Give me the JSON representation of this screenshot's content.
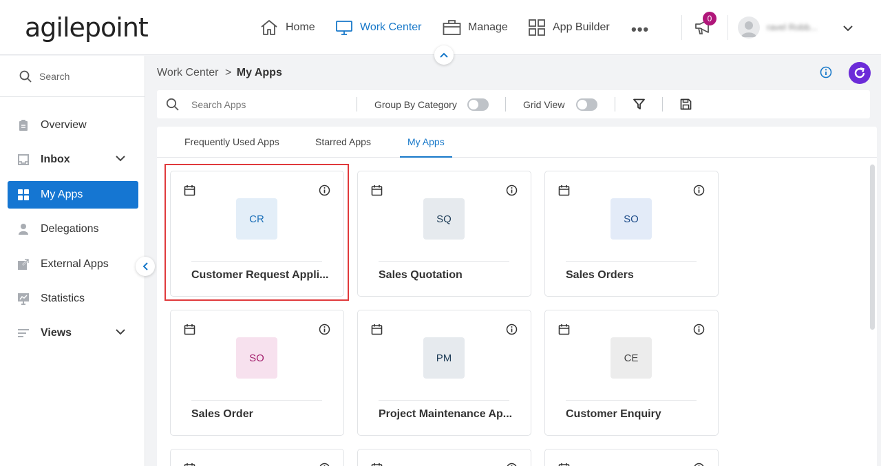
{
  "header": {
    "logo": "agilepoint",
    "nav": [
      {
        "label": "Home",
        "icon": "home-icon",
        "active": false
      },
      {
        "label": "Work Center",
        "icon": "monitor-icon",
        "active": true
      },
      {
        "label": "Manage",
        "icon": "briefcase-icon",
        "active": false
      },
      {
        "label": "App Builder",
        "icon": "grid-icon",
        "active": false
      }
    ],
    "more": "•••",
    "notification_count": "0",
    "username": "ravel Robb..."
  },
  "sidebar": {
    "search_placeholder": "Search",
    "items": [
      {
        "label": "Overview",
        "icon": "clipboard-icon"
      },
      {
        "label": "Inbox",
        "icon": "inbox-icon"
      },
      {
        "label": "My Apps",
        "icon": "apps-icon"
      },
      {
        "label": "Delegations",
        "icon": "person-icon"
      },
      {
        "label": "External Apps",
        "icon": "external-link-icon"
      },
      {
        "label": "Statistics",
        "icon": "chart-icon"
      },
      {
        "label": "Views",
        "icon": "list-icon"
      }
    ]
  },
  "breadcrumb": {
    "parent": "Work Center",
    "separator": ">",
    "current": "My Apps"
  },
  "toolbar": {
    "search_placeholder": "Search Apps",
    "group_by_label": "Group By Category",
    "grid_view_label": "Grid View"
  },
  "tabs": [
    {
      "label": "Frequently Used Apps"
    },
    {
      "label": "Starred Apps"
    },
    {
      "label": "My Apps"
    }
  ],
  "active_tab": "My Apps",
  "colors": {
    "accent": "#1576d2",
    "refresh": "#6b2bd8",
    "badge": "#b0167a",
    "highlight": "#e0393b"
  },
  "apps": [
    {
      "initials": "CR",
      "name": "Customer Request Appli...",
      "tile_bg": "#e3eef8",
      "tile_fg": "#1b6fb8"
    },
    {
      "initials": "SQ",
      "name": "Sales Quotation",
      "tile_bg": "#e6eaee",
      "tile_fg": "#1f3d57"
    },
    {
      "initials": "SO",
      "name": "Sales Orders",
      "tile_bg": "#e3ebf8",
      "tile_fg": "#1f4d8a"
    },
    {
      "initials": "SO",
      "name": "Sales Order",
      "tile_bg": "#f7e1ee",
      "tile_fg": "#a3206d"
    },
    {
      "initials": "PM",
      "name": "Project Maintenance Ap...",
      "tile_bg": "#e6eaee",
      "tile_fg": "#1f3d57"
    },
    {
      "initials": "CE",
      "name": "Customer Enquiry",
      "tile_bg": "#ececec",
      "tile_fg": "#444444"
    }
  ]
}
